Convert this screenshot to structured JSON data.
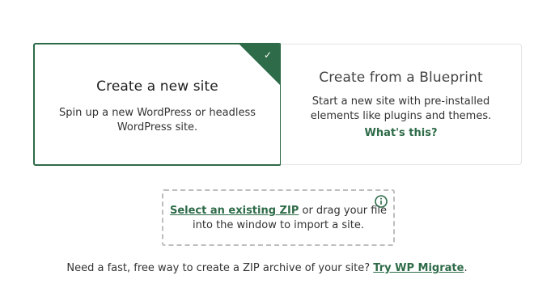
{
  "create_new": {
    "title": "Create a new site",
    "description": "Spin up a new WordPress or headless WordPress site.",
    "selected": true,
    "check_icon": "checkmark-icon"
  },
  "blueprint": {
    "title": "Create from a Blueprint",
    "description": "Start a new site with pre-installed elements like plugins and themes.",
    "link": "What's this?"
  },
  "import": {
    "link": "Select an existing ZIP",
    "text": " or drag your file into the window to import a site.",
    "info_icon": "info-circle-icon"
  },
  "footer": {
    "text": "Need a fast, free way to create a ZIP archive of your site? ",
    "link": "Try WP Migrate",
    "suffix": "."
  },
  "colors": {
    "accent": "#2e6b48",
    "border": "#e4e4e4",
    "dashed": "#bdbdbd"
  }
}
